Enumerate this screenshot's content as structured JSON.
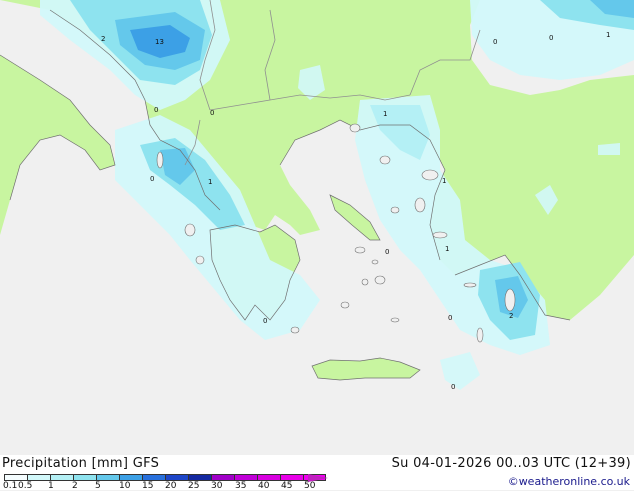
{
  "legend": {
    "title": "Precipitation [mm]  GFS",
    "timestamp": "Su 04-01-2026 00..03 UTC (12+39)",
    "credit": "©weatheronline.co.uk",
    "scale_labels": [
      "0.1",
      "0.5",
      "1",
      "2",
      "5",
      "10",
      "15",
      "20",
      "25",
      "30",
      "35",
      "40",
      "45",
      "50"
    ],
    "scale_colors": [
      "#f5fdff",
      "#d2f8fa",
      "#b4f0f5",
      "#8ee3ef",
      "#64c8eb",
      "#3ca0e6",
      "#2870dc",
      "#1e46c8",
      "#1428a0",
      "#a000c8",
      "#c000d8",
      "#d800e0",
      "#e800e8",
      "#f000f0"
    ]
  },
  "map_labels": [
    {
      "text": "2",
      "name": "value-label-adriatic-north"
    },
    {
      "text": "13",
      "name": "value-label-montenegro-coast"
    },
    {
      "text": "0",
      "name": "value-label-albania-coast"
    },
    {
      "text": "0",
      "name": "value-label-lake-ohrid"
    },
    {
      "text": "0",
      "name": "value-label-corfu"
    },
    {
      "text": "1",
      "name": "value-label-epirus"
    },
    {
      "text": "1",
      "name": "value-label-thrace"
    },
    {
      "text": "0",
      "name": "value-label-black-sea-west"
    },
    {
      "text": "0",
      "name": "value-label-black-sea-mid"
    },
    {
      "text": "1",
      "name": "value-label-black-sea-east"
    },
    {
      "text": "1",
      "name": "value-label-lesbos"
    },
    {
      "text": "0",
      "name": "value-label-central-aegean"
    },
    {
      "text": "1",
      "name": "value-label-samos"
    },
    {
      "text": "0",
      "name": "value-label-peloponnese-south"
    },
    {
      "text": "0",
      "name": "value-label-south-aegean"
    },
    {
      "text": "2",
      "name": "value-label-rhodes"
    },
    {
      "text": "0",
      "name": "value-label-crete-south"
    }
  ],
  "colors": {
    "sea": "#f0f0f0",
    "land": "#c8f5a0",
    "border": "#909090",
    "coast": "#707070"
  }
}
